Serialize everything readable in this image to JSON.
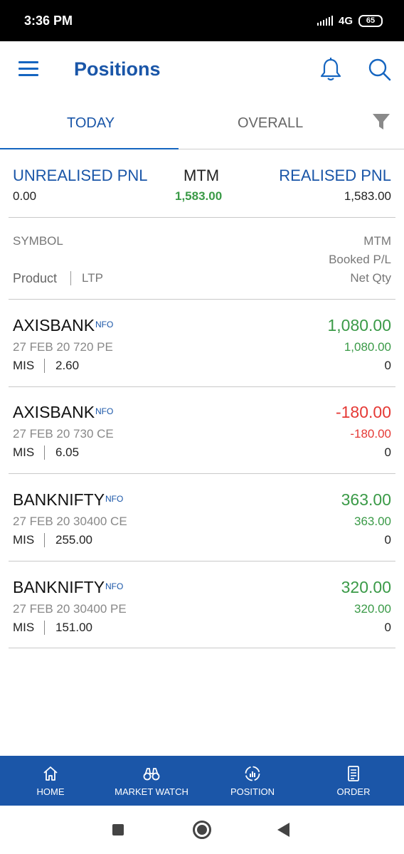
{
  "status_bar": {
    "time": "3:36 PM",
    "network": "4G",
    "battery": "65"
  },
  "app_bar": {
    "title": "Positions"
  },
  "tabs": [
    {
      "label": "TODAY"
    },
    {
      "label": "OVERALL"
    }
  ],
  "summary": {
    "unrealised_label": "UNREALISED PNL",
    "unrealised_value": "0.00",
    "mtm_label": "MTM",
    "mtm_value": "1,583.00",
    "realised_label": "REALISED PNL",
    "realised_value": "1,583.00"
  },
  "columns": {
    "symbol": "SYMBOL",
    "product": "Product",
    "ltp": "LTP",
    "mtm": "MTM",
    "booked": "Booked P/L",
    "net_qty": "Net Qty"
  },
  "positions": [
    {
      "symbol": "AXISBANK",
      "segment": "NFO",
      "contract": "27 FEB 20 720 PE",
      "product": "MIS",
      "ltp": "2.60",
      "mtm": "1,080.00",
      "booked": "1,080.00",
      "net_qty": "0"
    },
    {
      "symbol": "AXISBANK",
      "segment": "NFO",
      "contract": "27 FEB 20 730 CE",
      "product": "MIS",
      "ltp": "6.05",
      "mtm": "-180.00",
      "booked": "-180.00",
      "net_qty": "0"
    },
    {
      "symbol": "BANKNIFTY",
      "segment": "NFO",
      "contract": "27 FEB 20 30400 CE",
      "product": "MIS",
      "ltp": "255.00",
      "mtm": "363.00",
      "booked": "363.00",
      "net_qty": "0"
    },
    {
      "symbol": "BANKNIFTY",
      "segment": "NFO",
      "contract": "27 FEB 20 30400 PE",
      "product": "MIS",
      "ltp": "151.00",
      "mtm": "320.00",
      "booked": "320.00",
      "net_qty": "0"
    }
  ],
  "bottom_nav": [
    {
      "label": "HOME",
      "icon": "home-icon"
    },
    {
      "label": "MARKET WATCH",
      "icon": "binoculars-icon"
    },
    {
      "label": "POSITION",
      "icon": "position-icon"
    },
    {
      "label": "ORDER",
      "icon": "order-icon"
    }
  ],
  "colors": {
    "brand": "#1b56a8",
    "profit": "#3a9a47",
    "loss": "#e53935"
  }
}
